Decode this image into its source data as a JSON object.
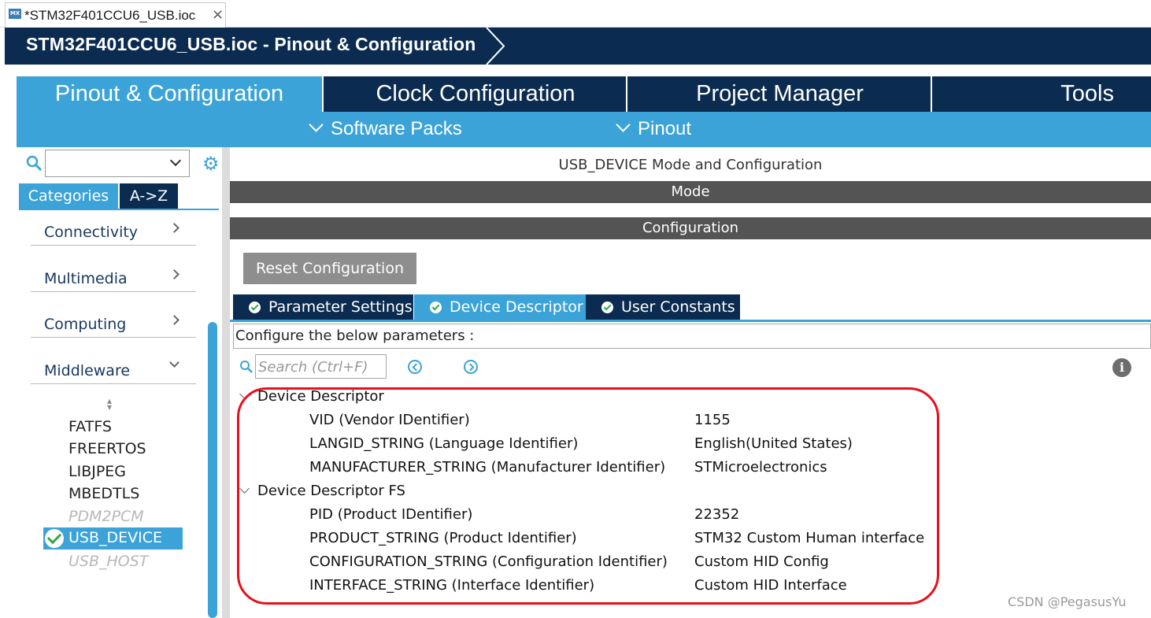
{
  "editor_tab": {
    "logo": "MX",
    "title": "*STM32F401CCU6_USB.ioc",
    "close": "×"
  },
  "header": {
    "title": "STM32F401CCU6_USB.ioc - Pinout & Configuration"
  },
  "main_tabs": [
    {
      "label": "Pinout & Configuration",
      "active": true
    },
    {
      "label": "Clock Configuration",
      "active": false
    },
    {
      "label": "Project Manager",
      "active": false
    },
    {
      "label": "Tools",
      "active": false
    }
  ],
  "sub_menu": {
    "software_packs": "Software Packs",
    "pinout": "Pinout"
  },
  "left_panel": {
    "search_value": "",
    "tabs": {
      "categories": "Categories",
      "az": "A->Z"
    },
    "categories": [
      "Connectivity",
      "Multimedia",
      "Computing",
      "Middleware"
    ],
    "middleware_items": [
      {
        "label": "FATFS",
        "enabled": true
      },
      {
        "label": "FREERTOS",
        "enabled": true
      },
      {
        "label": "LIBJPEG",
        "enabled": true
      },
      {
        "label": "MBEDTLS",
        "enabled": true
      },
      {
        "label": "PDM2PCM",
        "enabled": false
      },
      {
        "label": "USB_DEVICE",
        "enabled": true,
        "selected": true
      },
      {
        "label": "USB_HOST",
        "enabled": false
      }
    ]
  },
  "right_panel": {
    "title": "USB_DEVICE Mode and Configuration",
    "mode_label": "Mode",
    "configuration_label": "Configuration",
    "reset_button": "Reset Configuration",
    "config_tabs": [
      {
        "label": "Parameter Settings",
        "active": false
      },
      {
        "label": "Device Descriptor",
        "active": true
      },
      {
        "label": "User Constants",
        "active": false
      }
    ],
    "hint": "Configure the below parameters :",
    "search_placeholder": "Search (Ctrl+F)",
    "groups": [
      {
        "name": "Device Descriptor",
        "params": [
          {
            "name": "VID (Vendor IDentifier)",
            "value": "1155"
          },
          {
            "name": "LANGID_STRING (Language Identifier)",
            "value": "English(United States)"
          },
          {
            "name": "MANUFACTURER_STRING (Manufacturer Identifier)",
            "value": "STMicroelectronics"
          }
        ]
      },
      {
        "name": "Device Descriptor FS",
        "params": [
          {
            "name": "PID (Product IDentifier)",
            "value": "22352"
          },
          {
            "name": "PRODUCT_STRING (Product Identifier)",
            "value": "STM32 Custom Human interface"
          },
          {
            "name": "CONFIGURATION_STRING (Configuration Identifier)",
            "value": "Custom HID Config"
          },
          {
            "name": "INTERFACE_STRING (Interface Identifier)",
            "value": "Custom HID Interface"
          }
        ]
      }
    ]
  },
  "watermark": "CSDN @PegasusYu",
  "colors": {
    "navy": "#0b2c50",
    "accent": "#3ca3d9",
    "highlight": "#e8101a"
  }
}
